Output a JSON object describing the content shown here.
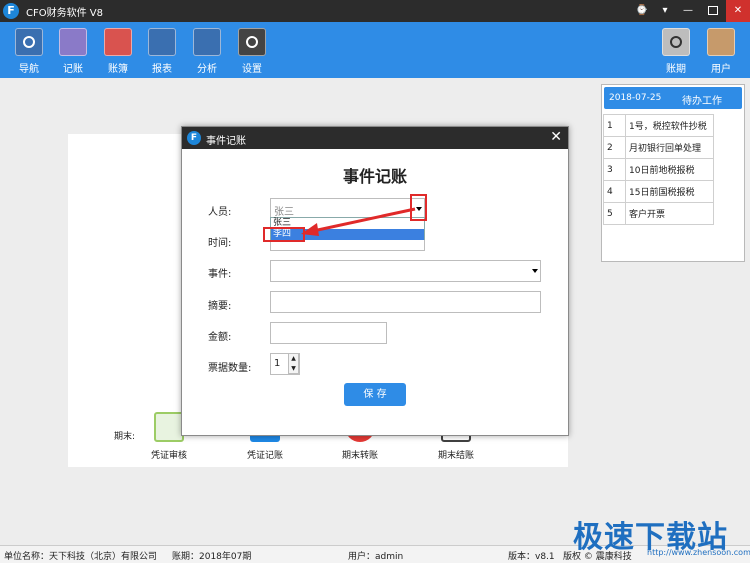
{
  "app": {
    "title": "CFO财务软件 V8",
    "logo_letter": "F"
  },
  "window_controls": {
    "help": "⌚",
    "menu": "▾",
    "minimize": "—",
    "close": "✕"
  },
  "toolbar": {
    "items": [
      {
        "label": "导航",
        "color": "#3a6fb0"
      },
      {
        "label": "记账",
        "color": "#8a7ac8"
      },
      {
        "label": "账簿",
        "color": "#d9534f"
      },
      {
        "label": "报表",
        "color": "#3a6fb0"
      },
      {
        "label": "分析",
        "color": "#3a6fb0"
      },
      {
        "label": "设置",
        "color": "#444444"
      }
    ],
    "right_items": [
      {
        "label": "账期",
        "color": "#bdbdbd"
      },
      {
        "label": "用户",
        "color": "#c69a6b"
      }
    ]
  },
  "todo": {
    "date": "2018-07-25",
    "title": "待办工作",
    "items": [
      {
        "no": "1",
        "text": "1号，税控软件抄税"
      },
      {
        "no": "2",
        "text": "月初银行回单处理"
      },
      {
        "no": "3",
        "text": "10日前地税报税"
      },
      {
        "no": "4",
        "text": "15日前国税报税"
      },
      {
        "no": "5",
        "text": "客户开票"
      }
    ]
  },
  "period": {
    "label": "期末:",
    "items": [
      {
        "label": "凭证审核",
        "color": "#9ccc65"
      },
      {
        "label": "凭证记账",
        "color": "#1e88e5"
      },
      {
        "label": "期末转账",
        "color": "#e53935"
      },
      {
        "label": "期末结账",
        "color": "#424242"
      }
    ]
  },
  "dialog": {
    "title": "事件记账",
    "heading": "事件记账",
    "close": "✕",
    "fields": {
      "person_label": "人员:",
      "person_value": "张三",
      "time_label": "时间:",
      "event_label": "事件:",
      "summary_label": "摘要:",
      "amount_label": "金额:",
      "bills_label": "票据数量:",
      "bills_value": "1"
    },
    "dropdown_options": [
      "张三",
      "李四"
    ],
    "save_label": "保 存"
  },
  "status": {
    "company": "单位名称：天下科技（北京）有限公司",
    "period": "账期：2018年07期",
    "user": "用户：admin",
    "version": "版本：v8.1",
    "copyright": "版权 © 震康科技"
  },
  "watermark": {
    "text": "极速下载站",
    "url": "http://www.zhensoon.com"
  },
  "accent_color": "#2f8ce6"
}
